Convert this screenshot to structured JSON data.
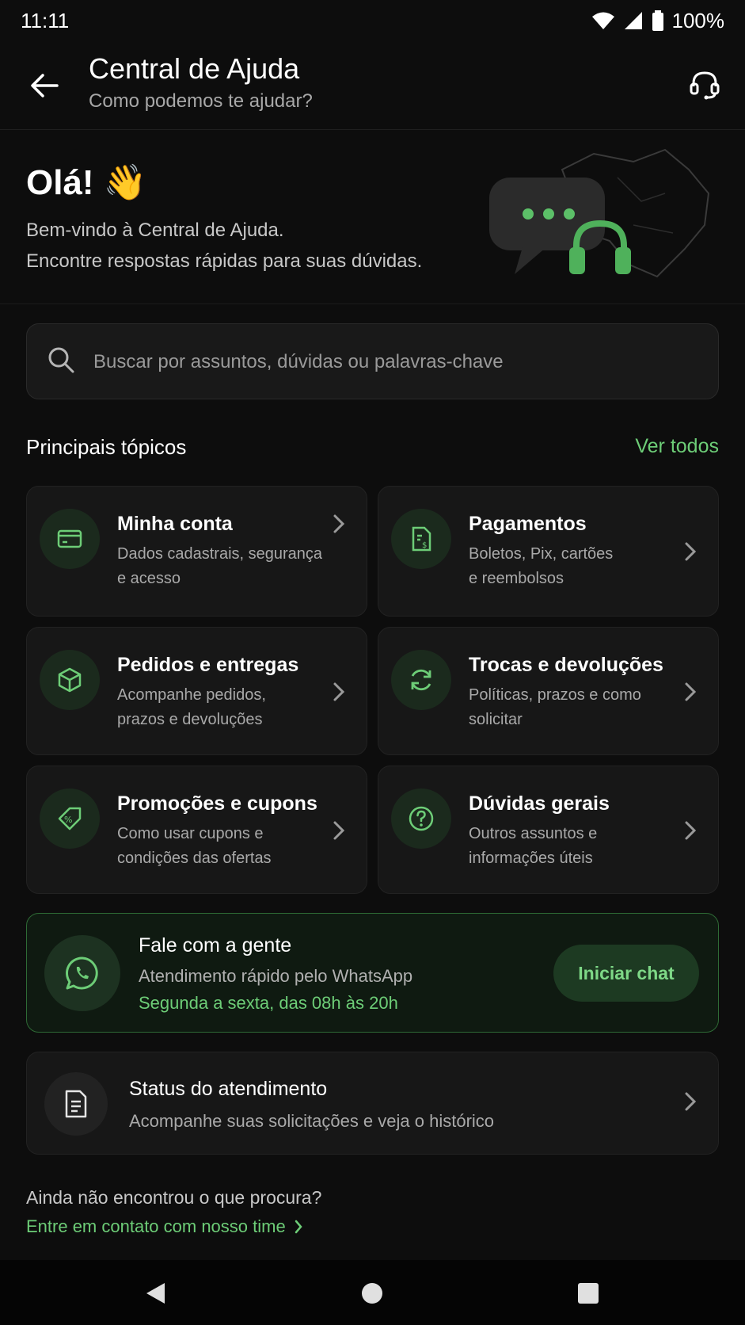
{
  "status_bar": {
    "time": "11:11",
    "battery": "100%"
  },
  "header": {
    "title": "Central de Ajuda",
    "subtitle": "Como podemos te ajudar?"
  },
  "hero": {
    "greeting": "Olá! 👋",
    "line1": "Bem-vindo à Central de Ajuda.",
    "line2": "Encontre respostas rápidas para suas dúvidas."
  },
  "search": {
    "placeholder": "Buscar por assuntos, dúvidas ou palavras-chave",
    "value": ""
  },
  "topics": {
    "title": "Principais tópicos",
    "see_all": "Ver todos",
    "items": [
      {
        "title": "Minha conta",
        "desc1": "Dados cadastrais, segurança",
        "desc2": "e acesso",
        "icon": "credit-card-icon"
      },
      {
        "title": "Pagamentos",
        "desc1": "Boletos, Pix, cartões",
        "desc2": "e reembolsos",
        "icon": "invoice-icon"
      },
      {
        "title": "Pedidos e entregas",
        "desc1": "Acompanhe pedidos,",
        "desc2": "prazos e devoluções",
        "icon": "box-icon"
      },
      {
        "title": "Trocas e devoluções",
        "desc1": "Políticas, prazos e como",
        "desc2": "solicitar",
        "icon": "refresh-icon"
      },
      {
        "title": "Promoções e cupons",
        "desc1": "Como usar cupons e",
        "desc2": "condições das ofertas",
        "icon": "coupon-icon"
      },
      {
        "title": "Dúvidas gerais",
        "desc1": "Outros assuntos e",
        "desc2": "informações úteis",
        "icon": "question-icon"
      }
    ]
  },
  "whatsapp": {
    "title": "Fale com a gente",
    "subtitle": "Atendimento rápido pelo WhatsApp",
    "hours": "Segunda a sexta, das 08h às 20h",
    "button": "Iniciar chat"
  },
  "support_status": {
    "title": "Status do atendimento",
    "subtitle": "Acompanhe suas solicitações e veja o histórico"
  },
  "footer": {
    "question": "Ainda não encontrou o que procura?",
    "link": "Entre em contato com nosso time"
  },
  "colors": {
    "accent": "#6dcd77",
    "background": "#0d0d0d",
    "card": "#171717"
  }
}
